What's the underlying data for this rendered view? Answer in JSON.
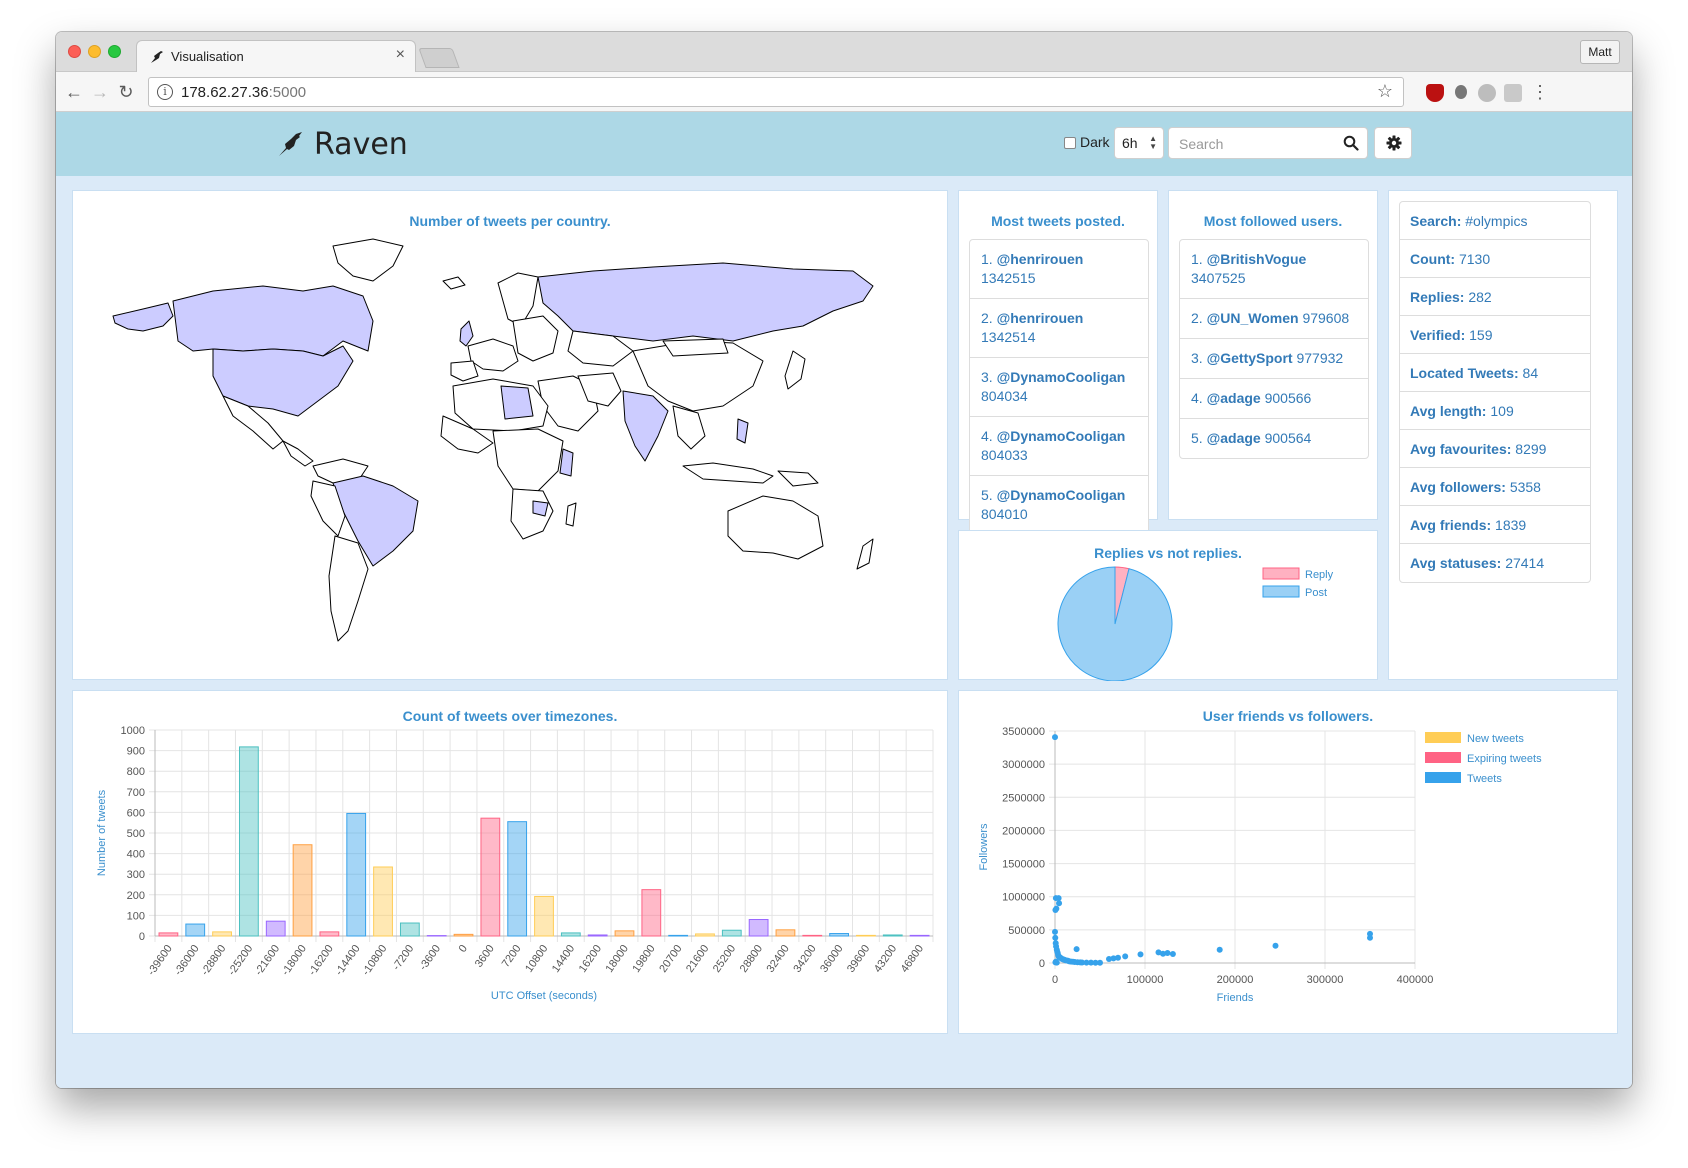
{
  "browser": {
    "tab_title": "Visualisation",
    "tab_close": "×",
    "user": "Matt",
    "url_host": "178.62.27.36",
    "url_port": ":5000",
    "back": "←",
    "forward": "→",
    "reload": "↻",
    "star": "☆",
    "menu": "⋮"
  },
  "header": {
    "brand": "Raven",
    "dark_label": "Dark",
    "time_value": "6h",
    "search_placeholder": "Search"
  },
  "map_panel": {
    "title": "Number of tweets per country."
  },
  "most_tweets": {
    "title": "Most tweets posted.",
    "items": [
      {
        "rank": "1.",
        "handle": "@henrirouen",
        "count": "1342515"
      },
      {
        "rank": "2.",
        "handle": "@henrirouen",
        "count": "1342514"
      },
      {
        "rank": "3.",
        "handle": "@DynamoCooligan",
        "count": "804034"
      },
      {
        "rank": "4.",
        "handle": "@DynamoCooligan",
        "count": "804033"
      },
      {
        "rank": "5.",
        "handle": "@DynamoCooligan",
        "count": "804010"
      }
    ]
  },
  "most_followed": {
    "title": "Most followed users.",
    "items": [
      {
        "rank": "1.",
        "handle": "@BritishVogue",
        "count": "3407525"
      },
      {
        "rank": "2.",
        "handle": "@UN_Women",
        "count": "979608"
      },
      {
        "rank": "3.",
        "handle": "@GettySport",
        "count": "977932"
      },
      {
        "rank": "4.",
        "handle": "@adage",
        "count": "900566"
      },
      {
        "rank": "5.",
        "handle": "@adage",
        "count": "900564"
      }
    ]
  },
  "stats": [
    {
      "label": "Search:",
      "value": "#olympics"
    },
    {
      "label": "Count:",
      "value": "7130"
    },
    {
      "label": "Replies:",
      "value": "282"
    },
    {
      "label": "Verified:",
      "value": "159"
    },
    {
      "label": "Located Tweets:",
      "value": "84"
    },
    {
      "label": "Avg length:",
      "value": "109"
    },
    {
      "label": "Avg favourites:",
      "value": "8299"
    },
    {
      "label": "Avg followers:",
      "value": "5358"
    },
    {
      "label": "Avg friends:",
      "value": "1839"
    },
    {
      "label": "Avg statuses:",
      "value": "27414"
    }
  ],
  "colors": {
    "accent": "#3a8fcd",
    "navbar": "#add8e6",
    "map_highlight": "#ccccff"
  },
  "chart_data": [
    {
      "type": "pie",
      "title": "Replies vs not replies.",
      "labels": [
        "Reply",
        "Post"
      ],
      "values": [
        282,
        6848
      ],
      "colors": [
        "#ffb1c1",
        "#9ad0f5"
      ],
      "legend": "right"
    },
    {
      "type": "bar",
      "title": "Count of tweets over timezones.",
      "xlabel": "UTC Offset (seconds)",
      "ylabel": "Number of tweets",
      "ylim": [
        0,
        1000
      ],
      "yticks": [
        "0",
        "100",
        "200",
        "300",
        "400",
        "500",
        "600",
        "700",
        "800",
        "900",
        "1000"
      ],
      "categories": [
        "-39600",
        "-36000",
        "-28800",
        "-25200",
        "-21600",
        "-18000",
        "-16200",
        "-14400",
        "-10800",
        "-7200",
        "-3600",
        "0",
        "3600",
        "7200",
        "10800",
        "14400",
        "16200",
        "18000",
        "19800",
        "20700",
        "21600",
        "25200",
        "28800",
        "32400",
        "34200",
        "36000",
        "39600",
        "43200",
        "46800"
      ],
      "values": [
        15,
        58,
        20,
        918,
        72,
        443,
        20,
        595,
        335,
        63,
        2,
        8,
        572,
        555,
        192,
        15,
        5,
        25,
        225,
        3,
        10,
        28,
        80,
        30,
        3,
        12,
        3,
        5,
        3
      ],
      "palette": [
        "#ff6384",
        "#36a2eb",
        "#ffcd56",
        "#4bc0c0",
        "#9966ff",
        "#ff9f40"
      ],
      "grid": true
    },
    {
      "type": "scatter",
      "title": "User friends vs followers.",
      "xlabel": "Friends",
      "ylabel": "Followers",
      "xlim": [
        0,
        400000
      ],
      "ylim": [
        0,
        3500000
      ],
      "xticks": [
        "0",
        "100000",
        "200000",
        "300000",
        "400000"
      ],
      "yticks": [
        "0",
        "500000",
        "1000000",
        "1500000",
        "2000000",
        "2500000",
        "3000000",
        "3500000"
      ],
      "legend": "top-right",
      "series": [
        {
          "name": "New tweets",
          "color": "#ffcd56",
          "points": []
        },
        {
          "name": "Expiring tweets",
          "color": "#ff6384",
          "points": []
        },
        {
          "name": "Tweets",
          "color": "#36a2eb",
          "points": [
            [
              0,
              3407525
            ],
            [
              1000,
              979608
            ],
            [
              4000,
              977932
            ],
            [
              4500,
              900566
            ],
            [
              500,
              800000
            ],
            [
              1500,
              820000
            ],
            [
              0,
              470000
            ],
            [
              300,
              380000
            ],
            [
              800,
              300000
            ],
            [
              1200,
              250000
            ],
            [
              2000,
              200000
            ],
            [
              2500,
              170000
            ],
            [
              3000,
              150000
            ],
            [
              3500,
              120000
            ],
            [
              4000,
              100000
            ],
            [
              5000,
              90000
            ],
            [
              6000,
              80000
            ],
            [
              7000,
              70000
            ],
            [
              8000,
              60000
            ],
            [
              9000,
              55000
            ],
            [
              10000,
              50000
            ],
            [
              11000,
              45000
            ],
            [
              12000,
              40000
            ],
            [
              14000,
              35000
            ],
            [
              15000,
              30000
            ],
            [
              16000,
              25000
            ],
            [
              18000,
              20000
            ],
            [
              20000,
              18000
            ],
            [
              22000,
              15000
            ],
            [
              25000,
              12000
            ],
            [
              28000,
              10000
            ],
            [
              30000,
              8000
            ],
            [
              35000,
              6000
            ],
            [
              40000,
              5000
            ],
            [
              45000,
              4000
            ],
            [
              50000,
              3000
            ],
            [
              24000,
              210000
            ],
            [
              60000,
              60000
            ],
            [
              65000,
              70000
            ],
            [
              70000,
              80000
            ],
            [
              78000,
              100000
            ],
            [
              95000,
              130000
            ],
            [
              115000,
              160000
            ],
            [
              120000,
              140000
            ],
            [
              125000,
              150000
            ],
            [
              131000,
              135000
            ],
            [
              183000,
              200000
            ],
            [
              245000,
              260000
            ],
            [
              350000,
              380000
            ],
            [
              350000,
              440000
            ],
            [
              2000,
              5000
            ],
            [
              500,
              10000
            ],
            [
              1000,
              20000
            ]
          ]
        }
      ]
    }
  ]
}
